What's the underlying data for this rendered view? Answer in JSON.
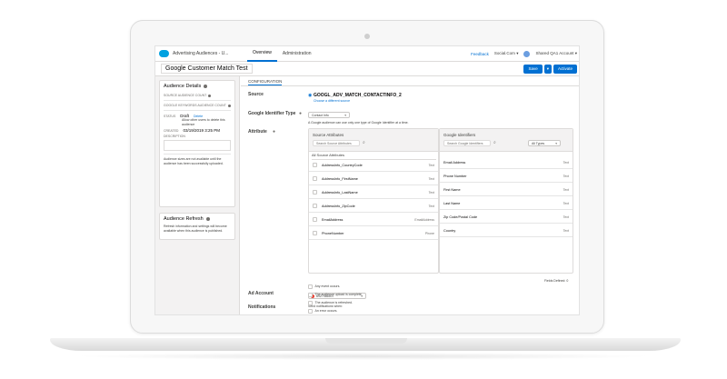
{
  "topbar": {
    "app_name": "Advertising Audiences - U...",
    "tabs": [
      {
        "label": "Overview"
      },
      {
        "label": "Administration"
      }
    ],
    "feedback": "Feedback",
    "social": "Social.Com",
    "social_caret": "▾",
    "account": "Shared QA1 Account ▾"
  },
  "header": {
    "title": "Google Customer Match Test",
    "save": "Save",
    "caret": "▾",
    "activate": "Activate"
  },
  "left": {
    "details_title": "Audience Details",
    "source_audience_count": "SOURCE AUDIENCE COUNT",
    "google_keywords_count": "GOOGLE KEYWORDS AUDIENCE COUNT",
    "status_label": "STATUS",
    "status_value": "Draft",
    "delete_link": "Delete",
    "allow_text": "Allow other users to delete this audience",
    "created_label": "CREATED",
    "created_value": "03/19/2019 3:25 PM",
    "description_label": "DESCRIPTION",
    "size_note": "Audience sizes are not available until the audience has been successfully uploaded.",
    "refresh_title": "Audience Refresh",
    "refresh_note": "Refresh information and settings will become available when this audience is published."
  },
  "main": {
    "config_tab": "CONFIGURATION",
    "source_label": "Source",
    "source_name": "GOOGL_ADV_MATCH_CONTACTINFO_2",
    "source_link": "Choose a different source",
    "gid_type_label": "Google Identifier Type",
    "gid_type_value": "Contact Info",
    "gid_hint": "A Google audience can use only one type of Google Identifier at a time.",
    "attribute_label": "Attribute",
    "source_attributes_title": "Source Attributes",
    "search_source_placeholder": "Search Source Attributes",
    "all_source": "All Source Attributes",
    "source_rows": [
      {
        "name": "AddressInfo_CountryCode",
        "type": "Text"
      },
      {
        "name": "AddressInfo_FirstName",
        "type": "Text"
      },
      {
        "name": "AddressInfo_LastName",
        "type": "Text"
      },
      {
        "name": "AddressInfo_ZipCode",
        "type": "Text"
      },
      {
        "name": "EmailAddress",
        "type": "EmailAddress"
      },
      {
        "name": "PhoneNumber",
        "type": "Phone"
      }
    ],
    "google_ids_title": "Google Identifiers",
    "search_google_placeholder": "Search Google Identifiers",
    "all_types": "All Types",
    "google_rows": [
      {
        "name": "Email Address",
        "type": "Text"
      },
      {
        "name": "Phone Number",
        "type": "Text"
      },
      {
        "name": "First Name",
        "type": "Text"
      },
      {
        "name": "Last Name",
        "type": "Text"
      },
      {
        "name": "Zip Code/Postal Code",
        "type": "Text"
      },
      {
        "name": "Country",
        "type": "Text"
      }
    ],
    "fields_defined": "Fields Defined: 0",
    "ad_account_label": "Ad Account",
    "ad_account_value": "8927466507",
    "notifications_label": "Notifications",
    "notif_intro": "Send notifications when:",
    "notif_options": [
      "Any event occurs.",
      "The audience upload is complete.",
      "The audience is refreshed.",
      "An error occurs."
    ]
  }
}
